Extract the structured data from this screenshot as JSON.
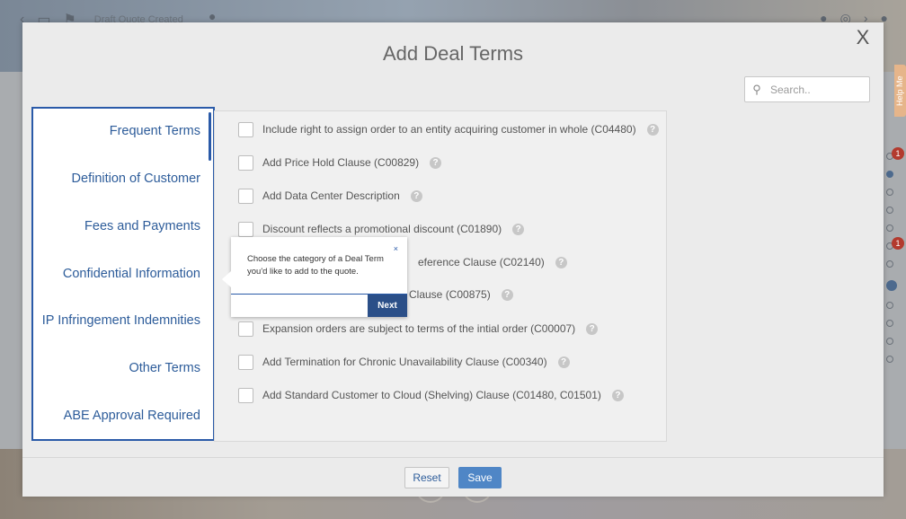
{
  "background": {
    "breadcrumb": "Draft Quote Created",
    "help_me_tab": "Help Me",
    "rail_badges": [
      "1",
      "1"
    ]
  },
  "modal": {
    "title": "Add Deal Terms",
    "close_label": "X",
    "search": {
      "placeholder": "Search.."
    },
    "categories": [
      "Frequent Terms",
      "Definition of Customer",
      "Fees and Payments",
      "Confidential Information",
      "IP Infringement Indemnities",
      "Other Terms",
      "ABE Approval Required"
    ],
    "terms": [
      "Include right to assign order to an entity acquiring customer in whole (C04480)",
      "Add Price Hold Clause (C00829)",
      "Add Data Center Description",
      "Discount reflects a promotional discount (C01890)",
      "eference Clause (C02140)",
      "Clause (C00875)",
      "Expansion orders are subject to terms of the intial order (C00007)",
      "Add Termination for Chronic Unavailability Clause (C00340)",
      "Add Standard Customer to Cloud (Shelving) Clause (C01480, C01501)"
    ],
    "help_glyph": "?",
    "footer": {
      "reset_label": "Reset",
      "save_label": "Save"
    }
  },
  "tooltip": {
    "text": "Choose the category of a Deal Term you'd like to add to the quote.",
    "close_label": "×",
    "next_label": "Next"
  },
  "colors": {
    "accent": "#2a5aa8",
    "save_button": "#4f86c6",
    "next_button": "#2b4f88"
  }
}
